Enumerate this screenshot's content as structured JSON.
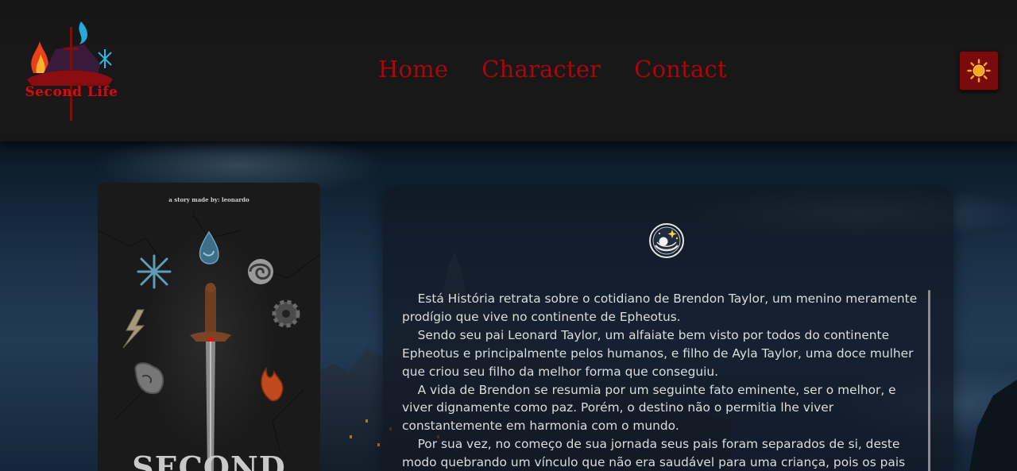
{
  "header": {
    "logo_text": "Second Life",
    "nav": [
      {
        "label": "Home"
      },
      {
        "label": "Character"
      },
      {
        "label": "Contact"
      }
    ],
    "theme_toggle_icon": "sun-icon"
  },
  "cover": {
    "credit": "a story made by: leonardo",
    "title": "SECOND",
    "element_icons": [
      "water-icon",
      "ice-icon",
      "wind-icon",
      "metal-icon",
      "lightning-icon",
      "earth-icon",
      "fire-icon",
      "sword-icon"
    ]
  },
  "story": {
    "emblem_icon": "moon-stars-icon",
    "paragraphs": [
      "Está História retrata sobre o cotidiano de Brendon Taylor, um menino meramente prodígio que vive no continente de Epheotus.",
      "Sendo seu pai Leonard Taylor, um alfaiate bem visto por todos do continente Epheotus e principalmente pelos humanos, e filho de Ayla Taylor, uma doce mulher que criou seu filho da melhor forma que conseguiu.",
      "A vida de Brendon se resumia por um seguinte fato eminente, ser o melhor, e viver dignamente como paz. Porém, o destino não o permitia lhe viver constantemente em harmonia com o mundo.",
      "Por sua vez, no começo de sua jornada seus pais foram separados de si, deste modo quebrando um vínculo que não era saudável para uma criança, pois os pais"
    ]
  },
  "colors": {
    "nav": "#a8070c",
    "theme_button": "#7a0a0b",
    "header_bg": "#181818"
  }
}
